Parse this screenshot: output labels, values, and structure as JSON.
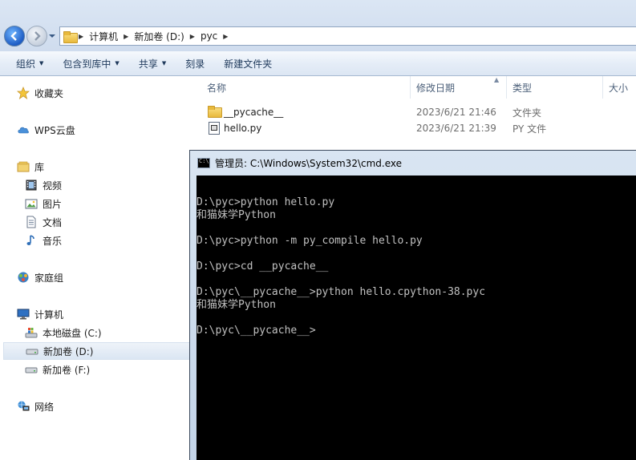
{
  "address_bar": {
    "crumbs": [
      "计算机",
      "新加卷 (D:)",
      "pyc"
    ]
  },
  "toolbar": {
    "organize": "组织",
    "include_in_library": "包含到库中",
    "share": "共享",
    "burn": "刻录",
    "new_folder": "新建文件夹"
  },
  "nav": {
    "favorites": "收藏夹",
    "wps_cloud": "WPS云盘",
    "libraries": "库",
    "videos": "视频",
    "pictures": "图片",
    "documents": "文档",
    "music": "音乐",
    "homegroup": "家庭组",
    "computer": "计算机",
    "local_disk_c": "本地磁盘 (C:)",
    "volume_d": "新加卷 (D:)",
    "volume_f": "新加卷 (F:)",
    "network": "网络"
  },
  "columns": {
    "name": "名称",
    "modified": "修改日期",
    "type": "类型",
    "size": "大小"
  },
  "files": [
    {
      "name": "__pycache__",
      "modified": "2023/6/21 21:46",
      "type": "文件夹",
      "icon": "folder-icon"
    },
    {
      "name": "hello.py",
      "modified": "2023/6/21 21:39",
      "type": "PY 文件",
      "icon": "python-file-icon"
    }
  ],
  "cmd": {
    "title": "管理员: C:\\Windows\\System32\\cmd.exe",
    "lines": [
      "",
      "D:\\pyc>python hello.py",
      "和猫妹学Python",
      "",
      "D:\\pyc>python -m py_compile hello.py",
      "",
      "D:\\pyc>cd __pycache__",
      "",
      "D:\\pyc\\__pycache__>python hello.cpython-38.pyc",
      "和猫妹学Python",
      "",
      "D:\\pyc\\__pycache__>"
    ]
  }
}
